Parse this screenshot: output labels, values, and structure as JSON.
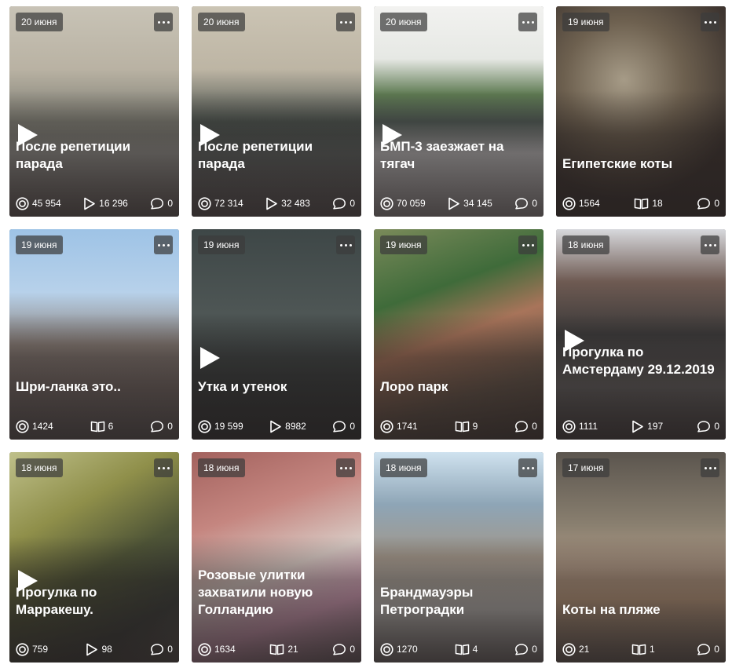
{
  "cards": [
    {
      "date": "20 июня",
      "title": "После репетиции парада",
      "video": true,
      "views": "45 954",
      "stat2_type": "play",
      "stat2": "16 296",
      "comments": "0"
    },
    {
      "date": "20 июня",
      "title": "После репетиции парада",
      "video": true,
      "views": "72 314",
      "stat2_type": "play",
      "stat2": "32 483",
      "comments": "0"
    },
    {
      "date": "20 июня",
      "title": "БМП-3 заезжает на тягач",
      "video": true,
      "views": "70 059",
      "stat2_type": "play",
      "stat2": "34 145",
      "comments": "0"
    },
    {
      "date": "19 июня",
      "title": "Египетские коты",
      "video": false,
      "views": "1564",
      "stat2_type": "read",
      "stat2": "18",
      "comments": "0"
    },
    {
      "date": "19 июня",
      "title": "Шри-ланка это..",
      "video": false,
      "views": "1424",
      "stat2_type": "read",
      "stat2": "6",
      "comments": "0"
    },
    {
      "date": "19 июня",
      "title": "Утка и утенок",
      "video": true,
      "views": "19 599",
      "stat2_type": "play",
      "stat2": "8982",
      "comments": "0"
    },
    {
      "date": "19 июня",
      "title": "Лоро парк",
      "video": false,
      "views": "1741",
      "stat2_type": "read",
      "stat2": "9",
      "comments": "0"
    },
    {
      "date": "18 июня",
      "title": "Прогулка по Амстердаму 29.12.2019",
      "video": true,
      "views": "1111",
      "stat2_type": "play",
      "stat2": "197",
      "comments": "0"
    },
    {
      "date": "18 июня",
      "title": "Прогулка по Марракешу.",
      "video": true,
      "views": "759",
      "stat2_type": "play",
      "stat2": "98",
      "comments": "0"
    },
    {
      "date": "18 июня",
      "title": "Розовые улитки захватили новую Голландию",
      "video": false,
      "views": "1634",
      "stat2_type": "read",
      "stat2": "21",
      "comments": "0"
    },
    {
      "date": "18 июня",
      "title": "Брандмауэры Петроградки",
      "video": false,
      "views": "1270",
      "stat2_type": "read",
      "stat2": "4",
      "comments": "0"
    },
    {
      "date": "17 июня",
      "title": "Коты на пляже",
      "video": false,
      "views": "21",
      "stat2_type": "read",
      "stat2": "1",
      "comments": "0"
    }
  ],
  "icons": {
    "views": "eye-circle-icon",
    "play": "play-outline-icon",
    "read": "open-book-icon",
    "comments": "comment-bubble-icon",
    "menu": "more-dots-icon",
    "video": "play-triangle-icon"
  },
  "colors": {
    "badge_bg": "#3c3c3c",
    "text": "#ffffff",
    "page_bg": "#ffffff"
  }
}
